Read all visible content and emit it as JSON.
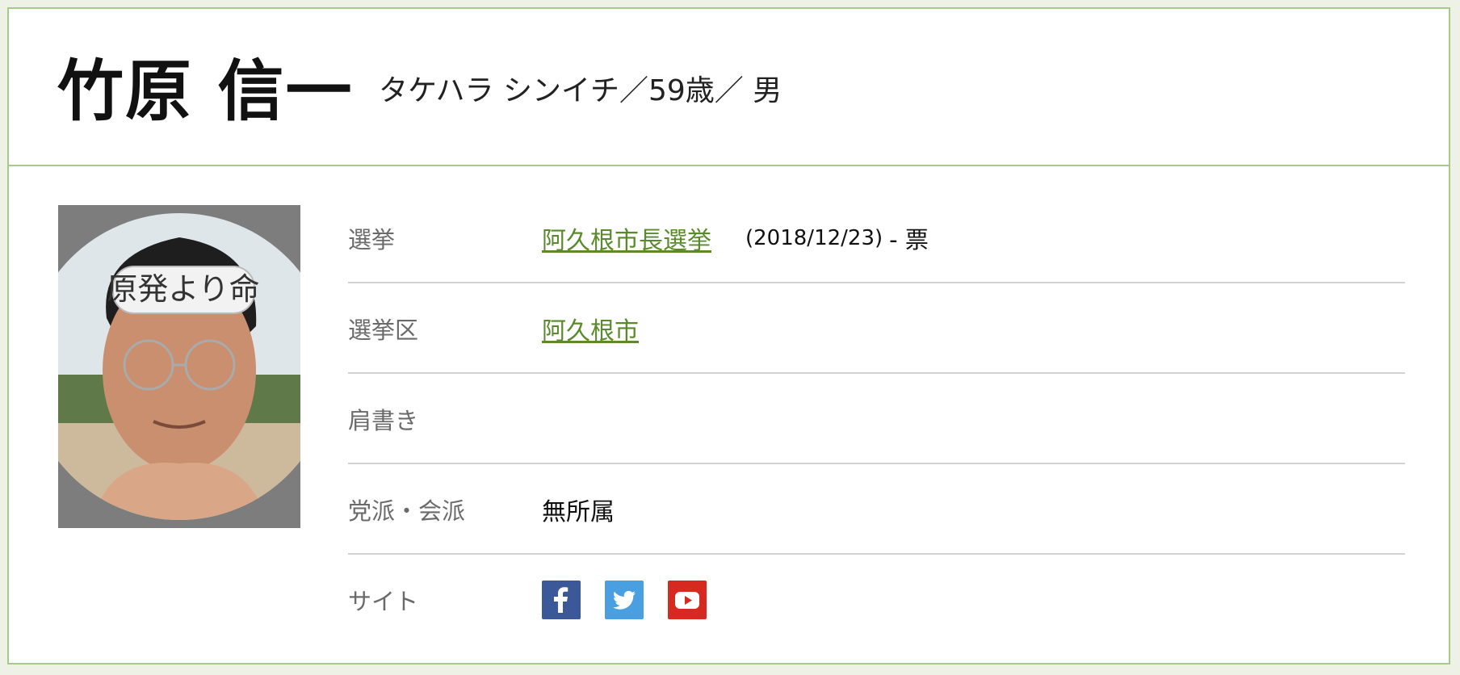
{
  "candidate": {
    "name": "竹原 信一",
    "meta": "タケハラ シンイチ／59歳／ 男",
    "photo": {
      "headband_text": "原発より命"
    }
  },
  "rows": [
    {
      "label": "選挙",
      "link": "阿久根市長選挙",
      "date": "(2018/12/23)",
      "votes": "- 票"
    },
    {
      "label": "選挙区",
      "link": "阿久根市"
    },
    {
      "label": "肩書き"
    },
    {
      "label": "党派・会派",
      "value": "無所属"
    },
    {
      "label": "サイト"
    }
  ],
  "social": [
    {
      "icon": "facebook-icon",
      "color": "#3b5998"
    },
    {
      "icon": "twitter-icon",
      "color": "#4a9fe0"
    },
    {
      "icon": "youtube-icon",
      "color": "#d62a20"
    }
  ],
  "colors": {
    "accent_border": "#a9c98a",
    "link": "#5a8a2b",
    "background": "#eef1e6"
  }
}
